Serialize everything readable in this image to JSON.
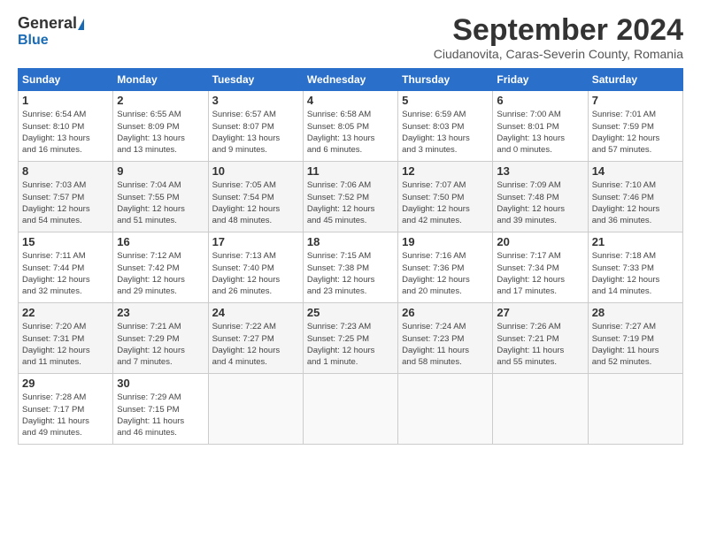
{
  "header": {
    "logo_general": "General",
    "logo_blue": "Blue",
    "month_title": "September 2024",
    "location": "Ciudanovita, Caras-Severin County, Romania"
  },
  "days_of_week": [
    "Sunday",
    "Monday",
    "Tuesday",
    "Wednesday",
    "Thursday",
    "Friday",
    "Saturday"
  ],
  "weeks": [
    [
      {
        "day": "1",
        "info": "Sunrise: 6:54 AM\nSunset: 8:10 PM\nDaylight: 13 hours\nand 16 minutes."
      },
      {
        "day": "2",
        "info": "Sunrise: 6:55 AM\nSunset: 8:09 PM\nDaylight: 13 hours\nand 13 minutes."
      },
      {
        "day": "3",
        "info": "Sunrise: 6:57 AM\nSunset: 8:07 PM\nDaylight: 13 hours\nand 9 minutes."
      },
      {
        "day": "4",
        "info": "Sunrise: 6:58 AM\nSunset: 8:05 PM\nDaylight: 13 hours\nand 6 minutes."
      },
      {
        "day": "5",
        "info": "Sunrise: 6:59 AM\nSunset: 8:03 PM\nDaylight: 13 hours\nand 3 minutes."
      },
      {
        "day": "6",
        "info": "Sunrise: 7:00 AM\nSunset: 8:01 PM\nDaylight: 13 hours\nand 0 minutes."
      },
      {
        "day": "7",
        "info": "Sunrise: 7:01 AM\nSunset: 7:59 PM\nDaylight: 12 hours\nand 57 minutes."
      }
    ],
    [
      {
        "day": "8",
        "info": "Sunrise: 7:03 AM\nSunset: 7:57 PM\nDaylight: 12 hours\nand 54 minutes."
      },
      {
        "day": "9",
        "info": "Sunrise: 7:04 AM\nSunset: 7:55 PM\nDaylight: 12 hours\nand 51 minutes."
      },
      {
        "day": "10",
        "info": "Sunrise: 7:05 AM\nSunset: 7:54 PM\nDaylight: 12 hours\nand 48 minutes."
      },
      {
        "day": "11",
        "info": "Sunrise: 7:06 AM\nSunset: 7:52 PM\nDaylight: 12 hours\nand 45 minutes."
      },
      {
        "day": "12",
        "info": "Sunrise: 7:07 AM\nSunset: 7:50 PM\nDaylight: 12 hours\nand 42 minutes."
      },
      {
        "day": "13",
        "info": "Sunrise: 7:09 AM\nSunset: 7:48 PM\nDaylight: 12 hours\nand 39 minutes."
      },
      {
        "day": "14",
        "info": "Sunrise: 7:10 AM\nSunset: 7:46 PM\nDaylight: 12 hours\nand 36 minutes."
      }
    ],
    [
      {
        "day": "15",
        "info": "Sunrise: 7:11 AM\nSunset: 7:44 PM\nDaylight: 12 hours\nand 32 minutes."
      },
      {
        "day": "16",
        "info": "Sunrise: 7:12 AM\nSunset: 7:42 PM\nDaylight: 12 hours\nand 29 minutes."
      },
      {
        "day": "17",
        "info": "Sunrise: 7:13 AM\nSunset: 7:40 PM\nDaylight: 12 hours\nand 26 minutes."
      },
      {
        "day": "18",
        "info": "Sunrise: 7:15 AM\nSunset: 7:38 PM\nDaylight: 12 hours\nand 23 minutes."
      },
      {
        "day": "19",
        "info": "Sunrise: 7:16 AM\nSunset: 7:36 PM\nDaylight: 12 hours\nand 20 minutes."
      },
      {
        "day": "20",
        "info": "Sunrise: 7:17 AM\nSunset: 7:34 PM\nDaylight: 12 hours\nand 17 minutes."
      },
      {
        "day": "21",
        "info": "Sunrise: 7:18 AM\nSunset: 7:33 PM\nDaylight: 12 hours\nand 14 minutes."
      }
    ],
    [
      {
        "day": "22",
        "info": "Sunrise: 7:20 AM\nSunset: 7:31 PM\nDaylight: 12 hours\nand 11 minutes."
      },
      {
        "day": "23",
        "info": "Sunrise: 7:21 AM\nSunset: 7:29 PM\nDaylight: 12 hours\nand 7 minutes."
      },
      {
        "day": "24",
        "info": "Sunrise: 7:22 AM\nSunset: 7:27 PM\nDaylight: 12 hours\nand 4 minutes."
      },
      {
        "day": "25",
        "info": "Sunrise: 7:23 AM\nSunset: 7:25 PM\nDaylight: 12 hours\nand 1 minute."
      },
      {
        "day": "26",
        "info": "Sunrise: 7:24 AM\nSunset: 7:23 PM\nDaylight: 11 hours\nand 58 minutes."
      },
      {
        "day": "27",
        "info": "Sunrise: 7:26 AM\nSunset: 7:21 PM\nDaylight: 11 hours\nand 55 minutes."
      },
      {
        "day": "28",
        "info": "Sunrise: 7:27 AM\nSunset: 7:19 PM\nDaylight: 11 hours\nand 52 minutes."
      }
    ],
    [
      {
        "day": "29",
        "info": "Sunrise: 7:28 AM\nSunset: 7:17 PM\nDaylight: 11 hours\nand 49 minutes."
      },
      {
        "day": "30",
        "info": "Sunrise: 7:29 AM\nSunset: 7:15 PM\nDaylight: 11 hours\nand 46 minutes."
      },
      {
        "day": "",
        "info": ""
      },
      {
        "day": "",
        "info": ""
      },
      {
        "day": "",
        "info": ""
      },
      {
        "day": "",
        "info": ""
      },
      {
        "day": "",
        "info": ""
      }
    ]
  ]
}
